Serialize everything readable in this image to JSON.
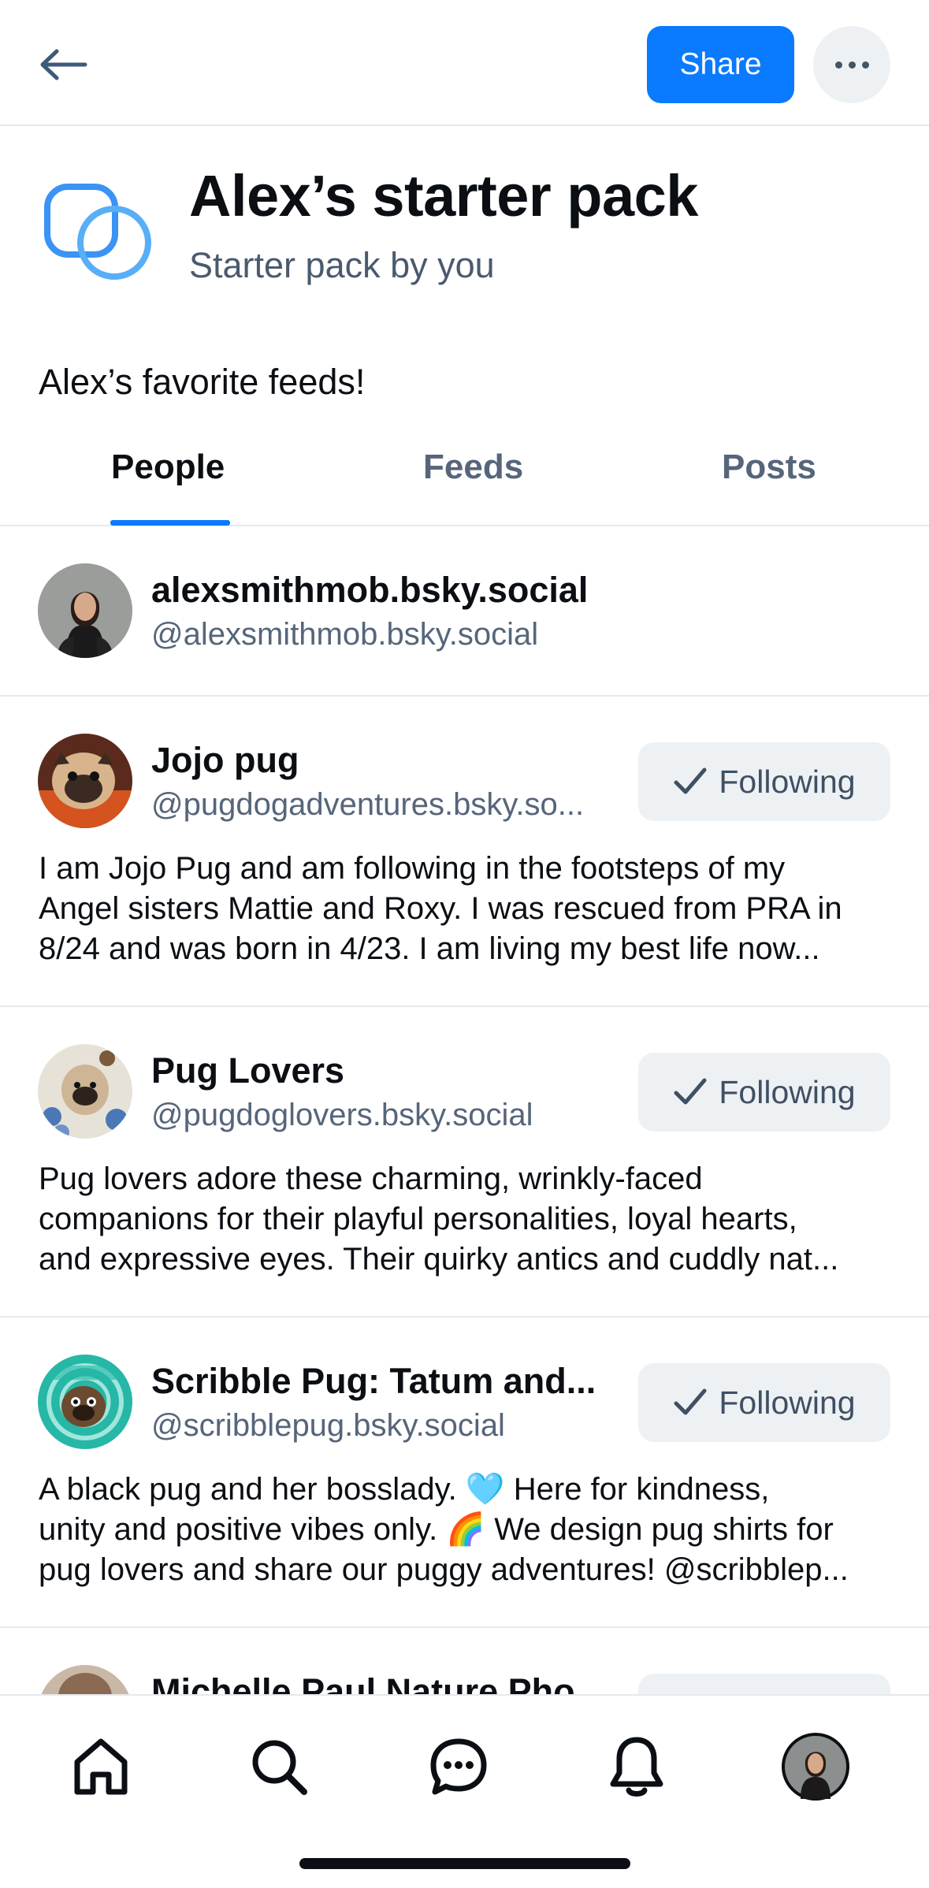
{
  "header": {
    "share_label": "Share",
    "back_icon": "arrow-left-icon",
    "more_icon": "ellipsis-icon"
  },
  "pack": {
    "title": "Alex’s starter pack",
    "subtitle": "Starter pack by you",
    "description": "Alex’s favorite feeds!",
    "icon": "starter-pack-icon",
    "accent": "#0a7aff"
  },
  "tabs": [
    {
      "label": "People",
      "active": true
    },
    {
      "label": "Feeds",
      "active": false
    },
    {
      "label": "Posts",
      "active": false
    }
  ],
  "people": [
    {
      "name": "alexsmithmob.bsky.social",
      "handle": "@alexsmithmob.bsky.social"
    },
    {
      "name": "Jojo pug",
      "handle": "@pugdogadventures.bsky.so...",
      "button": "Following",
      "bio": [
        "I am Jojo Pug and am following in the footsteps of my",
        "Angel sisters Mattie and Roxy.  I was rescued from PRA in",
        "8/24 and was born in 4/23.  I am living my best life now..."
      ]
    },
    {
      "name": "Pug Lovers",
      "handle": "@pugdoglovers.bsky.social",
      "button": "Following",
      "bio": [
        "Pug lovers adore these charming, wrinkly-faced",
        "companions for their playful personalities, loyal hearts,",
        "and expressive eyes. Their quirky antics and cuddly nat..."
      ]
    },
    {
      "name": "Scribble Pug: Tatum and...",
      "handle": "@scribblepug.bsky.social",
      "button": "Following",
      "bio": [
        "A black pug and her bosslady. 🩵 Here for kindness,",
        "unity and positive vibes only. 🌈 We design pug shirts for",
        "pug lovers and share our puggy adventures! @scribblep..."
      ]
    },
    {
      "name": "Michelle Paul Nature Pho"
    }
  ],
  "nav": [
    {
      "icon": "home-icon"
    },
    {
      "icon": "search-icon"
    },
    {
      "icon": "chat-icon"
    },
    {
      "icon": "bell-icon"
    },
    {
      "icon": "profile-avatar"
    }
  ],
  "colors": {
    "primary": "#0a7aff",
    "text": "#0b0f14",
    "muted": "#56657a",
    "button_bg": "#eef1f4"
  }
}
